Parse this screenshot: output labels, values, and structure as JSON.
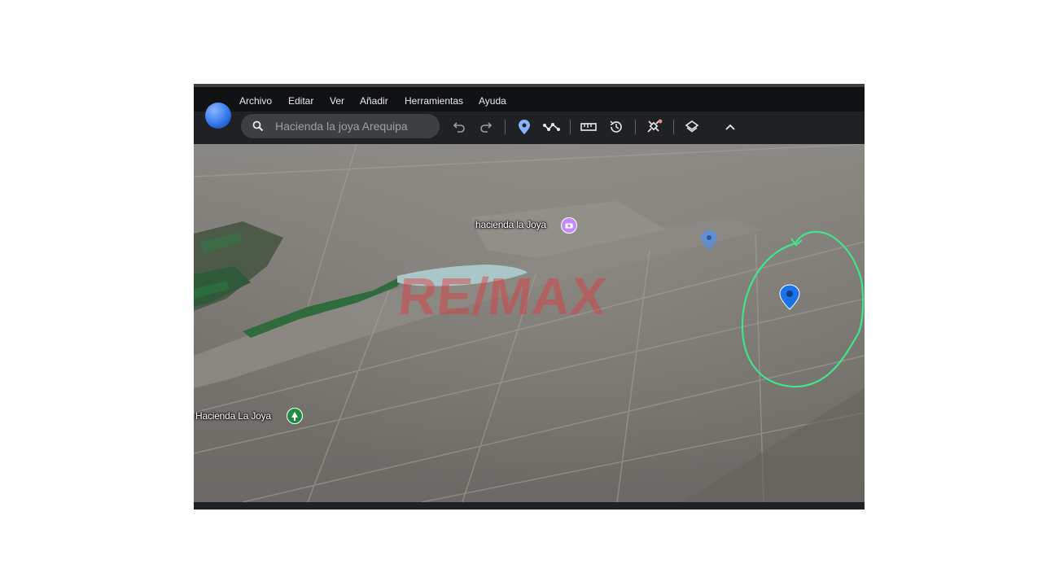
{
  "menu": [
    "Archivo",
    "Editar",
    "Ver",
    "Añadir",
    "Herramientas",
    "Ayuda"
  ],
  "search": {
    "placeholder": "Hacienda la joya Arequipa"
  },
  "toolbar": {
    "icons": [
      "undo-icon",
      "redo-icon",
      "placemark-icon",
      "path-icon",
      "ruler-icon",
      "history-icon",
      "satellite-icon",
      "layers-icon",
      "collapse-icon"
    ]
  },
  "map": {
    "labels": {
      "place_top": "hacienda la Joya",
      "place_bottom": "Hacienda La Joya"
    },
    "watermark": "RE/MAX",
    "colors": {
      "outline": "#3ee58a",
      "pin": "#1a73e8",
      "watermark": "#e0383e",
      "place_icon_top": "#c58af9",
      "place_icon_bottom": "#1e8e3e"
    }
  }
}
